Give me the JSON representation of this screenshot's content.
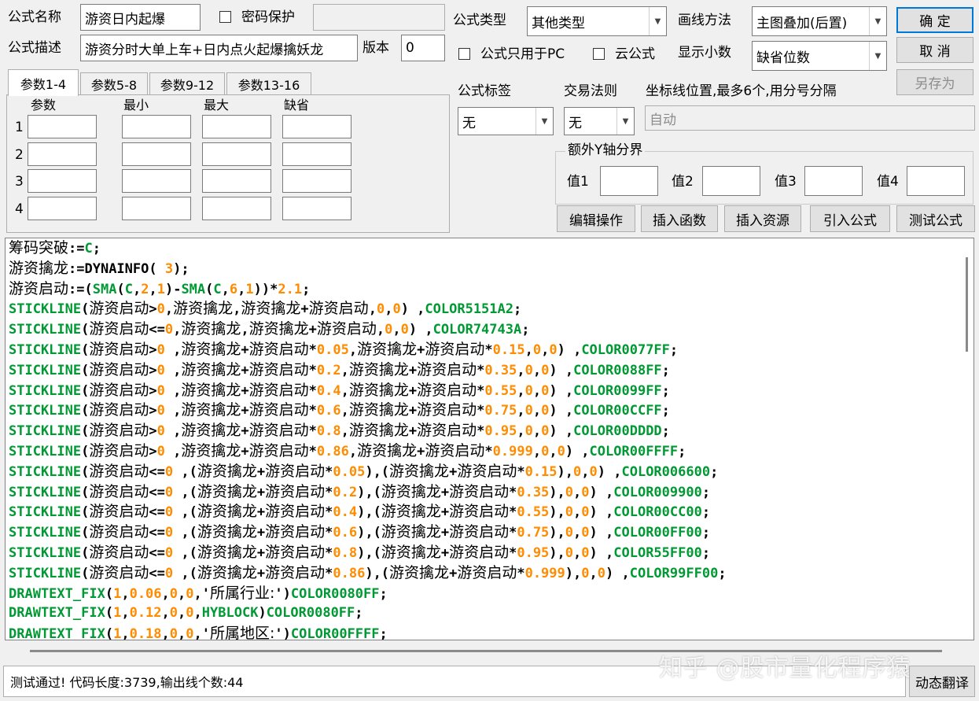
{
  "header": {
    "name_label": "公式名称",
    "name_value": "游资日内起爆",
    "password_label": "密码保护",
    "password_value": "",
    "desc_label": "公式描述",
    "desc_value": "游资分时大单上车+日内点火起爆擒妖龙",
    "version_label": "版本",
    "version_value": "0",
    "type_label": "公式类型",
    "type_value": "其他类型",
    "draw_label": "画线方法",
    "draw_value": "主图叠加(后置)",
    "pc_only_label": "公式只用于PC",
    "cloud_label": "云公式",
    "decimals_label": "显示小数",
    "decimals_value": "缺省位数"
  },
  "buttons": {
    "ok": "确  定",
    "cancel": "取  消",
    "save_as": "另存为",
    "edit_ops": "编辑操作",
    "insert_func": "插入函数",
    "insert_res": "插入资源",
    "import_formula": "引入公式",
    "test_formula": "测试公式",
    "dynamic_translate": "动态翻译"
  },
  "params": {
    "tabs": [
      "参数1-4",
      "参数5-8",
      "参数9-12",
      "参数13-16"
    ],
    "columns": [
      "参数",
      "最小",
      "最大",
      "缺省"
    ],
    "rows": [
      "1",
      "2",
      "3",
      "4"
    ]
  },
  "right_panel": {
    "tag_label": "公式标签",
    "tag_value": "无",
    "rule_label": "交易法则",
    "rule_value": "无",
    "coord_label": "坐标线位置,最多6个,用分号分隔",
    "coord_value": "自动",
    "yaxis_group": "额外Y轴分界",
    "yaxis_values": [
      "值1",
      "值2",
      "值3",
      "值4"
    ]
  },
  "code_lines": [
    [
      [
        "cn",
        "筹码突破"
      ],
      [
        "kw",
        ":="
      ],
      [
        "fn",
        "C"
      ],
      [
        "kw",
        ";"
      ]
    ],
    [
      [
        "cn",
        "游资擒龙"
      ],
      [
        "kw",
        ":=DYNAINFO( "
      ],
      [
        "num",
        "3"
      ],
      [
        "kw",
        ");"
      ]
    ],
    [
      [
        "cn",
        "游资启动"
      ],
      [
        "kw",
        ":=("
      ],
      [
        "fn",
        "SMA"
      ],
      [
        "kw",
        "("
      ],
      [
        "fn",
        "C"
      ],
      [
        "kw",
        ","
      ],
      [
        "num",
        "2"
      ],
      [
        "kw",
        ","
      ],
      [
        "num",
        "1"
      ],
      [
        "kw",
        ")-"
      ],
      [
        "fn",
        "SMA"
      ],
      [
        "kw",
        "("
      ],
      [
        "fn",
        "C"
      ],
      [
        "kw",
        ","
      ],
      [
        "num",
        "6"
      ],
      [
        "kw",
        ","
      ],
      [
        "num",
        "1"
      ],
      [
        "kw",
        "))*"
      ],
      [
        "num",
        "2.1"
      ],
      [
        "kw",
        ";"
      ]
    ],
    [
      [
        "fn",
        "STICKLINE"
      ],
      [
        "kw",
        "("
      ],
      [
        "cn",
        "游资启动"
      ],
      [
        "kw",
        ">"
      ],
      [
        "num",
        "0"
      ],
      [
        "kw",
        ","
      ],
      [
        "cn",
        "游资擒龙"
      ],
      [
        "kw",
        ","
      ],
      [
        "cn",
        "游资擒龙"
      ],
      [
        "kw",
        "+"
      ],
      [
        "cn",
        "游资启动"
      ],
      [
        "kw",
        ","
      ],
      [
        "num",
        "0"
      ],
      [
        "kw",
        ","
      ],
      [
        "num",
        "0"
      ],
      [
        "kw",
        ") ,"
      ],
      [
        "fn",
        "COLOR5151A2"
      ],
      [
        "kw",
        ";"
      ]
    ],
    [
      [
        "fn",
        "STICKLINE"
      ],
      [
        "kw",
        "("
      ],
      [
        "cn",
        "游资启动"
      ],
      [
        "kw",
        "<="
      ],
      [
        "num",
        "0"
      ],
      [
        "kw",
        ","
      ],
      [
        "cn",
        "游资擒龙"
      ],
      [
        "kw",
        ","
      ],
      [
        "cn",
        "游资擒龙"
      ],
      [
        "kw",
        "+"
      ],
      [
        "cn",
        "游资启动"
      ],
      [
        "kw",
        ","
      ],
      [
        "num",
        "0"
      ],
      [
        "kw",
        ","
      ],
      [
        "num",
        "0"
      ],
      [
        "kw",
        ") ,"
      ],
      [
        "fn",
        "COLOR74743A"
      ],
      [
        "kw",
        ";"
      ]
    ],
    [
      [
        "fn",
        "STICKLINE"
      ],
      [
        "kw",
        "("
      ],
      [
        "cn",
        "游资启动"
      ],
      [
        "kw",
        ">"
      ],
      [
        "num",
        "0"
      ],
      [
        "kw",
        " ,"
      ],
      [
        "cn",
        "游资擒龙"
      ],
      [
        "kw",
        "+"
      ],
      [
        "cn",
        "游资启动"
      ],
      [
        "kw",
        "*"
      ],
      [
        "num",
        "0.05"
      ],
      [
        "kw",
        ","
      ],
      [
        "cn",
        "游资擒龙"
      ],
      [
        "kw",
        "+"
      ],
      [
        "cn",
        "游资启动"
      ],
      [
        "kw",
        "*"
      ],
      [
        "num",
        "0.15"
      ],
      [
        "kw",
        ","
      ],
      [
        "num",
        "0"
      ],
      [
        "kw",
        ","
      ],
      [
        "num",
        "0"
      ],
      [
        "kw",
        ") ,"
      ],
      [
        "fn",
        "COLOR0077FF"
      ],
      [
        "kw",
        ";"
      ]
    ],
    [
      [
        "fn",
        "STICKLINE"
      ],
      [
        "kw",
        "("
      ],
      [
        "cn",
        "游资启动"
      ],
      [
        "kw",
        ">"
      ],
      [
        "num",
        "0"
      ],
      [
        "kw",
        " ,"
      ],
      [
        "cn",
        "游资擒龙"
      ],
      [
        "kw",
        "+"
      ],
      [
        "cn",
        "游资启动"
      ],
      [
        "kw",
        "*"
      ],
      [
        "num",
        "0.2"
      ],
      [
        "kw",
        ","
      ],
      [
        "cn",
        "游资擒龙"
      ],
      [
        "kw",
        "+"
      ],
      [
        "cn",
        "游资启动"
      ],
      [
        "kw",
        "*"
      ],
      [
        "num",
        "0.35"
      ],
      [
        "kw",
        ","
      ],
      [
        "num",
        "0"
      ],
      [
        "kw",
        ","
      ],
      [
        "num",
        "0"
      ],
      [
        "kw",
        ") ,"
      ],
      [
        "fn",
        "COLOR0088FF"
      ],
      [
        "kw",
        ";"
      ]
    ],
    [
      [
        "fn",
        "STICKLINE"
      ],
      [
        "kw",
        "("
      ],
      [
        "cn",
        "游资启动"
      ],
      [
        "kw",
        ">"
      ],
      [
        "num",
        "0"
      ],
      [
        "kw",
        " ,"
      ],
      [
        "cn",
        "游资擒龙"
      ],
      [
        "kw",
        "+"
      ],
      [
        "cn",
        "游资启动"
      ],
      [
        "kw",
        "*"
      ],
      [
        "num",
        "0.4"
      ],
      [
        "kw",
        ","
      ],
      [
        "cn",
        "游资擒龙"
      ],
      [
        "kw",
        "+"
      ],
      [
        "cn",
        "游资启动"
      ],
      [
        "kw",
        "*"
      ],
      [
        "num",
        "0.55"
      ],
      [
        "kw",
        ","
      ],
      [
        "num",
        "0"
      ],
      [
        "kw",
        ","
      ],
      [
        "num",
        "0"
      ],
      [
        "kw",
        ") ,"
      ],
      [
        "fn",
        "COLOR0099FF"
      ],
      [
        "kw",
        ";"
      ]
    ],
    [
      [
        "fn",
        "STICKLINE"
      ],
      [
        "kw",
        "("
      ],
      [
        "cn",
        "游资启动"
      ],
      [
        "kw",
        ">"
      ],
      [
        "num",
        "0"
      ],
      [
        "kw",
        " ,"
      ],
      [
        "cn",
        "游资擒龙"
      ],
      [
        "kw",
        "+"
      ],
      [
        "cn",
        "游资启动"
      ],
      [
        "kw",
        "*"
      ],
      [
        "num",
        "0.6"
      ],
      [
        "kw",
        ","
      ],
      [
        "cn",
        "游资擒龙"
      ],
      [
        "kw",
        "+"
      ],
      [
        "cn",
        "游资启动"
      ],
      [
        "kw",
        "*"
      ],
      [
        "num",
        "0.75"
      ],
      [
        "kw",
        ","
      ],
      [
        "num",
        "0"
      ],
      [
        "kw",
        ","
      ],
      [
        "num",
        "0"
      ],
      [
        "kw",
        ") ,"
      ],
      [
        "fn",
        "COLOR00CCFF"
      ],
      [
        "kw",
        ";"
      ]
    ],
    [
      [
        "fn",
        "STICKLINE"
      ],
      [
        "kw",
        "("
      ],
      [
        "cn",
        "游资启动"
      ],
      [
        "kw",
        ">"
      ],
      [
        "num",
        "0"
      ],
      [
        "kw",
        " ,"
      ],
      [
        "cn",
        "游资擒龙"
      ],
      [
        "kw",
        "+"
      ],
      [
        "cn",
        "游资启动"
      ],
      [
        "kw",
        "*"
      ],
      [
        "num",
        "0.8"
      ],
      [
        "kw",
        ","
      ],
      [
        "cn",
        "游资擒龙"
      ],
      [
        "kw",
        "+"
      ],
      [
        "cn",
        "游资启动"
      ],
      [
        "kw",
        "*"
      ],
      [
        "num",
        "0.95"
      ],
      [
        "kw",
        ","
      ],
      [
        "num",
        "0"
      ],
      [
        "kw",
        ","
      ],
      [
        "num",
        "0"
      ],
      [
        "kw",
        ") ,"
      ],
      [
        "fn",
        "COLOR00DDDD"
      ],
      [
        "kw",
        ";"
      ]
    ],
    [
      [
        "fn",
        "STICKLINE"
      ],
      [
        "kw",
        "("
      ],
      [
        "cn",
        "游资启动"
      ],
      [
        "kw",
        ">"
      ],
      [
        "num",
        "0"
      ],
      [
        "kw",
        " ,"
      ],
      [
        "cn",
        "游资擒龙"
      ],
      [
        "kw",
        "+"
      ],
      [
        "cn",
        "游资启动"
      ],
      [
        "kw",
        "*"
      ],
      [
        "num",
        "0.86"
      ],
      [
        "kw",
        ","
      ],
      [
        "cn",
        "游资擒龙"
      ],
      [
        "kw",
        "+"
      ],
      [
        "cn",
        "游资启动"
      ],
      [
        "kw",
        "*"
      ],
      [
        "num",
        "0.999"
      ],
      [
        "kw",
        ","
      ],
      [
        "num",
        "0"
      ],
      [
        "kw",
        ","
      ],
      [
        "num",
        "0"
      ],
      [
        "kw",
        ") ,"
      ],
      [
        "fn",
        "COLOR00FFFF"
      ],
      [
        "kw",
        ";"
      ]
    ],
    [
      [
        "fn",
        "STICKLINE"
      ],
      [
        "kw",
        "("
      ],
      [
        "cn",
        "游资启动"
      ],
      [
        "kw",
        "<="
      ],
      [
        "num",
        "0"
      ],
      [
        "kw",
        " ,("
      ],
      [
        "cn",
        "游资擒龙"
      ],
      [
        "kw",
        "+"
      ],
      [
        "cn",
        "游资启动"
      ],
      [
        "kw",
        "*"
      ],
      [
        "num",
        "0.05"
      ],
      [
        "kw",
        "),("
      ],
      [
        "cn",
        "游资擒龙"
      ],
      [
        "kw",
        "+"
      ],
      [
        "cn",
        "游资启动"
      ],
      [
        "kw",
        "*"
      ],
      [
        "num",
        "0.15"
      ],
      [
        "kw",
        "),"
      ],
      [
        "num",
        "0"
      ],
      [
        "kw",
        ","
      ],
      [
        "num",
        "0"
      ],
      [
        "kw",
        ") ,"
      ],
      [
        "fn",
        "COLOR006600"
      ],
      [
        "kw",
        ";"
      ]
    ],
    [
      [
        "fn",
        "STICKLINE"
      ],
      [
        "kw",
        "("
      ],
      [
        "cn",
        "游资启动"
      ],
      [
        "kw",
        "<="
      ],
      [
        "num",
        "0"
      ],
      [
        "kw",
        " ,("
      ],
      [
        "cn",
        "游资擒龙"
      ],
      [
        "kw",
        "+"
      ],
      [
        "cn",
        "游资启动"
      ],
      [
        "kw",
        "*"
      ],
      [
        "num",
        "0.2"
      ],
      [
        "kw",
        "),("
      ],
      [
        "cn",
        "游资擒龙"
      ],
      [
        "kw",
        "+"
      ],
      [
        "cn",
        "游资启动"
      ],
      [
        "kw",
        "*"
      ],
      [
        "num",
        "0.35"
      ],
      [
        "kw",
        "),"
      ],
      [
        "num",
        "0"
      ],
      [
        "kw",
        ","
      ],
      [
        "num",
        "0"
      ],
      [
        "kw",
        ") ,"
      ],
      [
        "fn",
        "COLOR009900"
      ],
      [
        "kw",
        ";"
      ]
    ],
    [
      [
        "fn",
        "STICKLINE"
      ],
      [
        "kw",
        "("
      ],
      [
        "cn",
        "游资启动"
      ],
      [
        "kw",
        "<="
      ],
      [
        "num",
        "0"
      ],
      [
        "kw",
        " ,("
      ],
      [
        "cn",
        "游资擒龙"
      ],
      [
        "kw",
        "+"
      ],
      [
        "cn",
        "游资启动"
      ],
      [
        "kw",
        "*"
      ],
      [
        "num",
        "0.4"
      ],
      [
        "kw",
        "),("
      ],
      [
        "cn",
        "游资擒龙"
      ],
      [
        "kw",
        "+"
      ],
      [
        "cn",
        "游资启动"
      ],
      [
        "kw",
        "*"
      ],
      [
        "num",
        "0.55"
      ],
      [
        "kw",
        "),"
      ],
      [
        "num",
        "0"
      ],
      [
        "kw",
        ","
      ],
      [
        "num",
        "0"
      ],
      [
        "kw",
        ") ,"
      ],
      [
        "fn",
        "COLOR00CC00"
      ],
      [
        "kw",
        ";"
      ]
    ],
    [
      [
        "fn",
        "STICKLINE"
      ],
      [
        "kw",
        "("
      ],
      [
        "cn",
        "游资启动"
      ],
      [
        "kw",
        "<="
      ],
      [
        "num",
        "0"
      ],
      [
        "kw",
        " ,("
      ],
      [
        "cn",
        "游资擒龙"
      ],
      [
        "kw",
        "+"
      ],
      [
        "cn",
        "游资启动"
      ],
      [
        "kw",
        "*"
      ],
      [
        "num",
        "0.6"
      ],
      [
        "kw",
        "),("
      ],
      [
        "cn",
        "游资擒龙"
      ],
      [
        "kw",
        "+"
      ],
      [
        "cn",
        "游资启动"
      ],
      [
        "kw",
        "*"
      ],
      [
        "num",
        "0.75"
      ],
      [
        "kw",
        "),"
      ],
      [
        "num",
        "0"
      ],
      [
        "kw",
        ","
      ],
      [
        "num",
        "0"
      ],
      [
        "kw",
        ") ,"
      ],
      [
        "fn",
        "COLOR00FF00"
      ],
      [
        "kw",
        ";"
      ]
    ],
    [
      [
        "fn",
        "STICKLINE"
      ],
      [
        "kw",
        "("
      ],
      [
        "cn",
        "游资启动"
      ],
      [
        "kw",
        "<="
      ],
      [
        "num",
        "0"
      ],
      [
        "kw",
        " ,("
      ],
      [
        "cn",
        "游资擒龙"
      ],
      [
        "kw",
        "+"
      ],
      [
        "cn",
        "游资启动"
      ],
      [
        "kw",
        "*"
      ],
      [
        "num",
        "0.8"
      ],
      [
        "kw",
        "),("
      ],
      [
        "cn",
        "游资擒龙"
      ],
      [
        "kw",
        "+"
      ],
      [
        "cn",
        "游资启动"
      ],
      [
        "kw",
        "*"
      ],
      [
        "num",
        "0.95"
      ],
      [
        "kw",
        "),"
      ],
      [
        "num",
        "0"
      ],
      [
        "kw",
        ","
      ],
      [
        "num",
        "0"
      ],
      [
        "kw",
        ") ,"
      ],
      [
        "fn",
        "COLOR55FF00"
      ],
      [
        "kw",
        ";"
      ]
    ],
    [
      [
        "fn",
        "STICKLINE"
      ],
      [
        "kw",
        "("
      ],
      [
        "cn",
        "游资启动"
      ],
      [
        "kw",
        "<="
      ],
      [
        "num",
        "0"
      ],
      [
        "kw",
        " ,("
      ],
      [
        "cn",
        "游资擒龙"
      ],
      [
        "kw",
        "+"
      ],
      [
        "cn",
        "游资启动"
      ],
      [
        "kw",
        "*"
      ],
      [
        "num",
        "0.86"
      ],
      [
        "kw",
        "),("
      ],
      [
        "cn",
        "游资擒龙"
      ],
      [
        "kw",
        "+"
      ],
      [
        "cn",
        "游资启动"
      ],
      [
        "kw",
        "*"
      ],
      [
        "num",
        "0.999"
      ],
      [
        "kw",
        "),"
      ],
      [
        "num",
        "0"
      ],
      [
        "kw",
        ","
      ],
      [
        "num",
        "0"
      ],
      [
        "kw",
        ") ,"
      ],
      [
        "fn",
        "COLOR99FF00"
      ],
      [
        "kw",
        ";"
      ]
    ],
    [
      [
        "fn",
        "DRAWTEXT_FIX"
      ],
      [
        "kw",
        "("
      ],
      [
        "num",
        "1"
      ],
      [
        "kw",
        ","
      ],
      [
        "num",
        "0.06"
      ],
      [
        "kw",
        ","
      ],
      [
        "num",
        "0"
      ],
      [
        "kw",
        ","
      ],
      [
        "num",
        "0"
      ],
      [
        "kw",
        ",'"
      ],
      [
        "cn",
        "所属行业:"
      ],
      [
        "kw",
        "')"
      ],
      [
        "fn",
        "COLOR0080FF"
      ],
      [
        "kw",
        ";"
      ]
    ],
    [
      [
        "fn",
        "DRAWTEXT_FIX"
      ],
      [
        "kw",
        "("
      ],
      [
        "num",
        "1"
      ],
      [
        "kw",
        ","
      ],
      [
        "num",
        "0.12"
      ],
      [
        "kw",
        ","
      ],
      [
        "num",
        "0"
      ],
      [
        "kw",
        ","
      ],
      [
        "num",
        "0"
      ],
      [
        "kw",
        ","
      ],
      [
        "fn",
        "HYBLOCK"
      ],
      [
        "kw",
        ")"
      ],
      [
        "fn",
        "COLOR0080FF"
      ],
      [
        "kw",
        ";"
      ]
    ],
    [
      [
        "fn",
        "DRAWTEXT_FIX"
      ],
      [
        "kw",
        "("
      ],
      [
        "num",
        "1"
      ],
      [
        "kw",
        ","
      ],
      [
        "num",
        "0.18"
      ],
      [
        "kw",
        ","
      ],
      [
        "num",
        "0"
      ],
      [
        "kw",
        ","
      ],
      [
        "num",
        "0"
      ],
      [
        "kw",
        ",'"
      ],
      [
        "cn",
        "所属地区:"
      ],
      [
        "kw",
        "')"
      ],
      [
        "fn",
        "COLOR00FFFF"
      ],
      [
        "kw",
        ";"
      ]
    ]
  ],
  "status": {
    "message": "测试通过! 代码长度:3739,输出线个数:44"
  },
  "watermark": "知乎 @股市量化程序猿",
  "colors": {
    "function": "#009933",
    "number": "#ff8c00",
    "accent": "#0078d7"
  }
}
